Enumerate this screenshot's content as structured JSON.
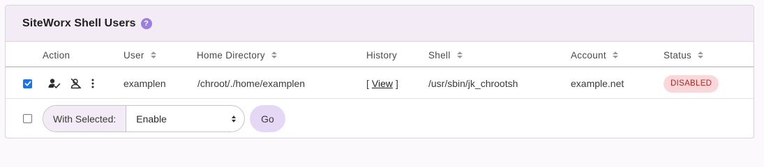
{
  "panel": {
    "title": "SiteWorx Shell Users",
    "help_icon": "question-circle-icon",
    "help_glyph": "?"
  },
  "table": {
    "columns": {
      "action": "Action",
      "user": "User",
      "home": "Home Directory",
      "history": "History",
      "shell": "Shell",
      "account": "Account",
      "status": "Status"
    },
    "rows": [
      {
        "selected": true,
        "user": "examplen",
        "home": "/chroot/./home/examplen",
        "history_open": "[",
        "history_link": "View",
        "history_close": "]",
        "shell": "/usr/sbin/jk_chrootsh",
        "account": "example.net",
        "status": "DISABLED",
        "actions": [
          "edit-user-icon",
          "disable-user-icon",
          "more-options-icon"
        ]
      }
    ]
  },
  "footer": {
    "with_selected_label": "With Selected:",
    "selected_action": "Enable",
    "go_label": "Go"
  },
  "colors": {
    "accent": "#9b7fe0",
    "header_bg": "#f3ecf6",
    "badge_bg": "#f9d7da",
    "badge_text": "#b3261e",
    "checkbox": "#1a73e8"
  }
}
